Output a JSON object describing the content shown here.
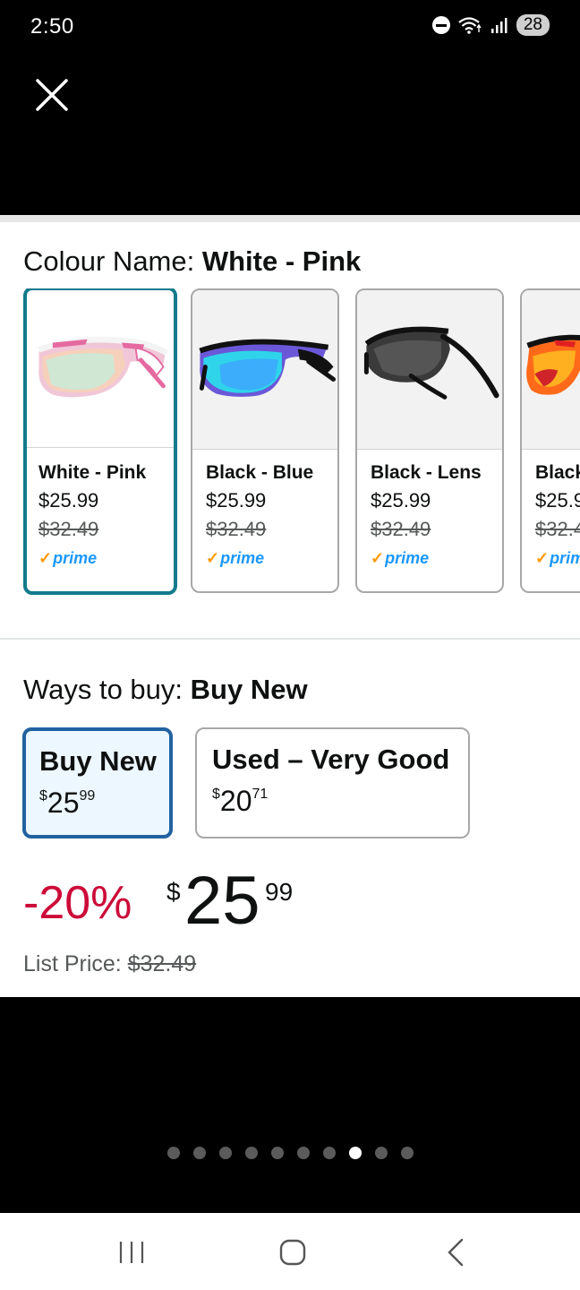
{
  "status_bar": {
    "time": "2:50",
    "battery": "28"
  },
  "colour_section": {
    "label": "Colour Name: ",
    "selected": "White - Pink",
    "swatches": [
      {
        "name": "White - Pink",
        "price": "$25.99",
        "list_price": "$32.49",
        "prime": "prime",
        "selected": true
      },
      {
        "name": "Black - Blue",
        "price": "$25.99",
        "list_price": "$32.49",
        "prime": "prime",
        "selected": false
      },
      {
        "name": "Black - Lens",
        "price": "$25.99",
        "list_price": "$32.49",
        "prime": "prime",
        "selected": false
      },
      {
        "name": "Black",
        "price": "$25.9",
        "list_price": "$32.4",
        "prime": "prim",
        "selected": false
      }
    ]
  },
  "ways_to_buy": {
    "label": "Ways to buy: ",
    "selected": "Buy New",
    "options": [
      {
        "label": "Buy New",
        "currency": "$",
        "whole": "25",
        "fraction": "99",
        "selected": true
      },
      {
        "label": "Used – Very Good",
        "currency": "$",
        "whole": "20",
        "fraction": "71",
        "selected": false
      }
    ]
  },
  "price_block": {
    "discount": "-20%",
    "currency": "$",
    "whole": "25",
    "fraction": "99",
    "list_price_label": "List Price: ",
    "list_price_value": "$32.49"
  },
  "carousel": {
    "total": 10,
    "active_index": 7
  },
  "colors": {
    "accent_teal": "#127a8c",
    "accent_blue": "#2162a1",
    "discount_red": "#cc0c39",
    "prime_blue": "#1a98ff",
    "prime_check": "#ff9900"
  }
}
